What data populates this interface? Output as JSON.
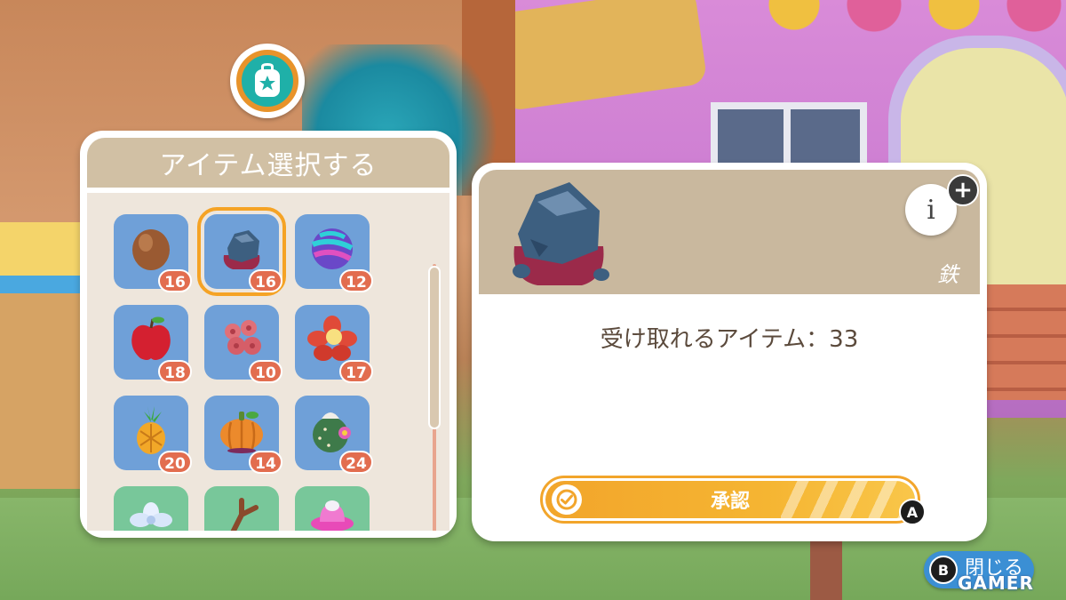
{
  "colors": {
    "panel_header": "#d1c0a4",
    "tile_blue": "#6fa0d8",
    "tile_green": "#78c79a",
    "count_badge": "#e26d4f",
    "selected_outline": "#f5a325",
    "confirm_orange": "#f2a52b",
    "close_blue": "#3b8fd4"
  },
  "left_panel": {
    "title": "アイテム選択する",
    "items": [
      {
        "icon": "coconut-icon",
        "count": "16",
        "selected": false
      },
      {
        "icon": "iron-ore-icon",
        "count": "16",
        "selected": true
      },
      {
        "icon": "striped-marble-icon",
        "count": "12",
        "selected": false
      },
      {
        "icon": "apple-icon",
        "count": "18",
        "selected": false
      },
      {
        "icon": "coral-icon",
        "count": "10",
        "selected": false
      },
      {
        "icon": "hibiscus-flower-icon",
        "count": "17",
        "selected": false
      },
      {
        "icon": "pineapple-icon",
        "count": "20",
        "selected": false
      },
      {
        "icon": "pumpkin-icon",
        "count": "14",
        "selected": false
      },
      {
        "icon": "cactus-ball-icon",
        "count": "24",
        "selected": false
      },
      {
        "icon": "white-flower-icon",
        "count": "",
        "selected": false
      },
      {
        "icon": "branch-icon",
        "count": "",
        "selected": false
      },
      {
        "icon": "pink-hat-icon",
        "count": "",
        "selected": false
      }
    ]
  },
  "detail": {
    "item_name": "鉄",
    "info_glyph": "i",
    "plus_glyph": "+",
    "receive_text": "受け取れるアイテム：33",
    "confirm_label": "承認",
    "confirm_button_hint": "A"
  },
  "close": {
    "button_hint": "B",
    "label": "閉じる"
  },
  "watermark": "GAMER"
}
